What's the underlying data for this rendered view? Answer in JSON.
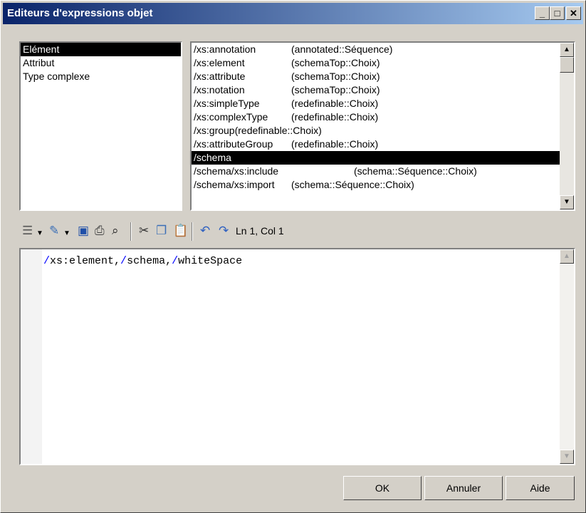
{
  "window": {
    "title": "Editeurs d'expressions objet",
    "buttons": {
      "minimize": "_",
      "maximize": "□",
      "close": "✕"
    }
  },
  "left_list": {
    "items": [
      {
        "label": "Elément",
        "selected": true
      },
      {
        "label": "Attribut",
        "selected": false
      },
      {
        "label": "Type complexe",
        "selected": false
      }
    ]
  },
  "right_list": {
    "items": [
      {
        "path": "/xs:annotation",
        "group": "(annotated::Séquence)",
        "selected": false
      },
      {
        "path": "/xs:element",
        "group": "(schemaTop::Choix)",
        "selected": false
      },
      {
        "path": "/xs:attribute",
        "group": "(schemaTop::Choix)",
        "selected": false
      },
      {
        "path": "/xs:notation",
        "group": "(schemaTop::Choix)",
        "selected": false
      },
      {
        "path": "/xs:simpleType",
        "group": "(redefinable::Choix)",
        "selected": false
      },
      {
        "path": "/xs:complexType",
        "group": "(redefinable::Choix)",
        "selected": false
      },
      {
        "path": "/xs:group(redefinable::Choix)",
        "group": "",
        "selected": false
      },
      {
        "path": "/xs:attributeGroup",
        "group": "(redefinable::Choix)",
        "selected": false
      },
      {
        "path": "/schema",
        "group": "",
        "selected": true
      },
      {
        "path": "/schema/xs:include",
        "group": "(schema::Séquence::Choix)",
        "selected": false,
        "group_offset": "wide"
      },
      {
        "path": "/schema/xs:import",
        "group": "(schema::Séquence::Choix)",
        "selected": false
      }
    ]
  },
  "toolbar": {
    "icons": [
      "text-format-icon",
      "dropdown-arrow-icon",
      "edit-icon",
      "dropdown-arrow-icon",
      "save-icon",
      "print-icon",
      "find-icon",
      "cut-icon",
      "copy-icon",
      "paste-icon",
      "undo-icon",
      "redo-icon"
    ],
    "status": "Ln 1, Col 1"
  },
  "editor": {
    "tokens": [
      {
        "text": "/",
        "color": "#0000ff"
      },
      {
        "text": "xs:element,",
        "color": "#000000"
      },
      {
        "text": "/",
        "color": "#0000ff"
      },
      {
        "text": "schema,",
        "color": "#000000"
      },
      {
        "text": "/",
        "color": "#0000ff"
      },
      {
        "text": "whiteSpace",
        "color": "#000000"
      }
    ]
  },
  "buttons": {
    "ok": "OK",
    "cancel": "Annuler",
    "help": "Aide"
  }
}
